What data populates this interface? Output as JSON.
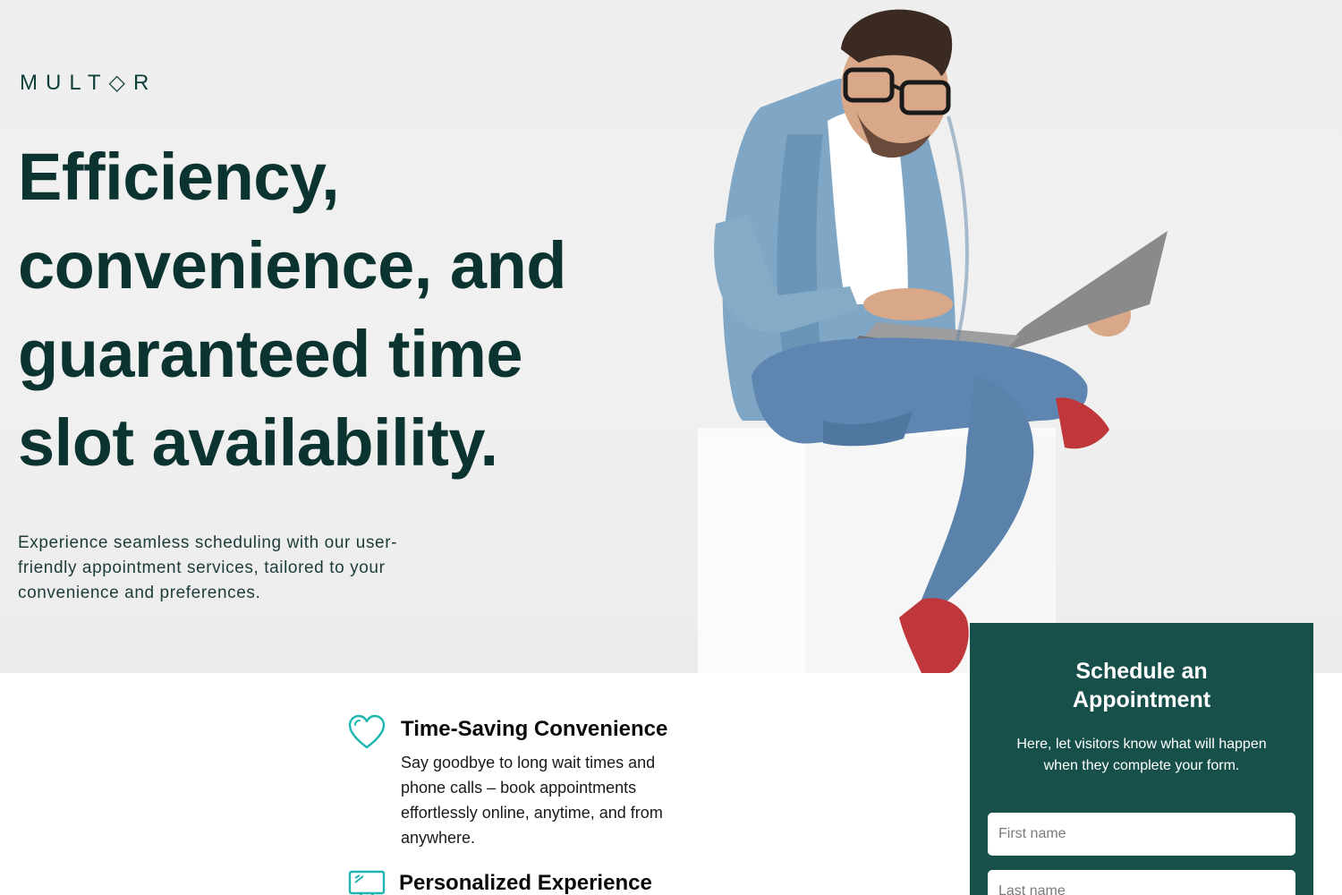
{
  "brand": {
    "logo_text": "MULT◇R"
  },
  "hero": {
    "headline": "Efficiency, convenience, and guaranteed time slot availability.",
    "subtext": "Experience seamless scheduling with our user-friendly appointment services, tailored to your convenience and preferences."
  },
  "features": [
    {
      "icon": "heart-icon",
      "title": "Time-Saving Convenience",
      "description": "Say goodbye to long wait times and phone calls – book appointments effortlessly online, anytime, and from anywhere."
    },
    {
      "icon": "monitor-icon",
      "title": "Personalized Experience",
      "description": ""
    }
  ],
  "form": {
    "title": "Schedule an Appointment",
    "description": "Here, let visitors know what will happen when they complete your form.",
    "first_name_placeholder": "First name",
    "last_name_placeholder": "Last name"
  },
  "colors": {
    "brand_dark": "#0b3330",
    "form_background": "#17504a",
    "icon_accent": "#1fb6b1"
  }
}
